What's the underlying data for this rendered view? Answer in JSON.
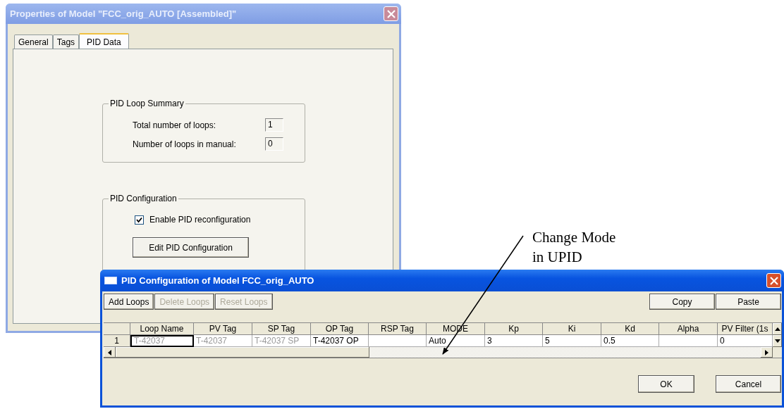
{
  "properties_window": {
    "title": "Properties of Model \"FCC_orig_AUTO [Assembled]\"",
    "tabs": [
      {
        "label": "General",
        "selected": false
      },
      {
        "label": "Tags",
        "selected": false
      },
      {
        "label": "PID Data",
        "selected": true
      }
    ],
    "loop_summary": {
      "title": "PID Loop Summary",
      "fields": [
        {
          "label": "Total number of loops:",
          "value": "1"
        },
        {
          "label": "Number of loops in manual:",
          "value": "0"
        }
      ]
    },
    "configuration": {
      "title": "PID Configuration",
      "checkbox": {
        "label": "Enable PID reconfiguration",
        "checked": true
      },
      "button": "Edit PID Configuration"
    }
  },
  "pid_window": {
    "title": "PID Configuration of Model FCC_orig_AUTO",
    "toolbar_left": [
      {
        "label": "Add Loops",
        "disabled": false
      },
      {
        "label": "Delete Loops",
        "disabled": true
      },
      {
        "label": "Reset Loops",
        "disabled": true
      }
    ],
    "toolbar_right": [
      {
        "label": "Copy",
        "disabled": false
      },
      {
        "label": "Paste",
        "disabled": false
      }
    ],
    "table": {
      "columns": [
        "Loop Name",
        "PV Tag",
        "SP Tag",
        "OP Tag",
        "RSP Tag",
        "MODE",
        "Kp",
        "Ki",
        "Kd",
        "Alpha",
        "PV Filter (1s"
      ],
      "rows": [
        {
          "number": "1",
          "cells": [
            {
              "text": "T-42037",
              "disabled": true
            },
            {
              "text": "T-42037",
              "disabled": true
            },
            {
              "text": "T-42037 SP",
              "disabled": true
            },
            {
              "text": "T-42037 OP",
              "disabled": false
            },
            {
              "text": ""
            },
            {
              "text": "Auto",
              "disabled": false
            },
            {
              "text": "3",
              "disabled": false
            },
            {
              "text": "5",
              "disabled": false
            },
            {
              "text": "0.5",
              "disabled": false
            },
            {
              "text": ""
            },
            {
              "text": "0",
              "disabled": false
            }
          ]
        }
      ]
    },
    "buttons": [
      "OK",
      "Cancel"
    ]
  },
  "annotation": {
    "lines": [
      "Change Mode",
      "in UPID"
    ]
  }
}
